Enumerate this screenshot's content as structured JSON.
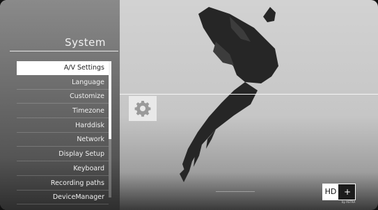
{
  "sidebar": {
    "title": "System",
    "items": [
      {
        "label": "A/V Settings",
        "active": true
      },
      {
        "label": "Language",
        "active": false
      },
      {
        "label": "Customize",
        "active": false
      },
      {
        "label": "Timezone",
        "active": false
      },
      {
        "label": "Harddisk",
        "active": false
      },
      {
        "label": "Network",
        "active": false
      },
      {
        "label": "Display Setup",
        "active": false
      },
      {
        "label": "Keyboard",
        "active": false
      },
      {
        "label": "Recording paths",
        "active": false
      },
      {
        "label": "DeviceManager",
        "active": false
      }
    ]
  },
  "settings_icon": "gear-icon",
  "badge": {
    "left": "HD",
    "right": "+",
    "sub": "by ASTRA"
  },
  "colors": {
    "highlight": "#ffffff",
    "sidebar": "#6e6e6e",
    "background": "#c8c8c8"
  }
}
